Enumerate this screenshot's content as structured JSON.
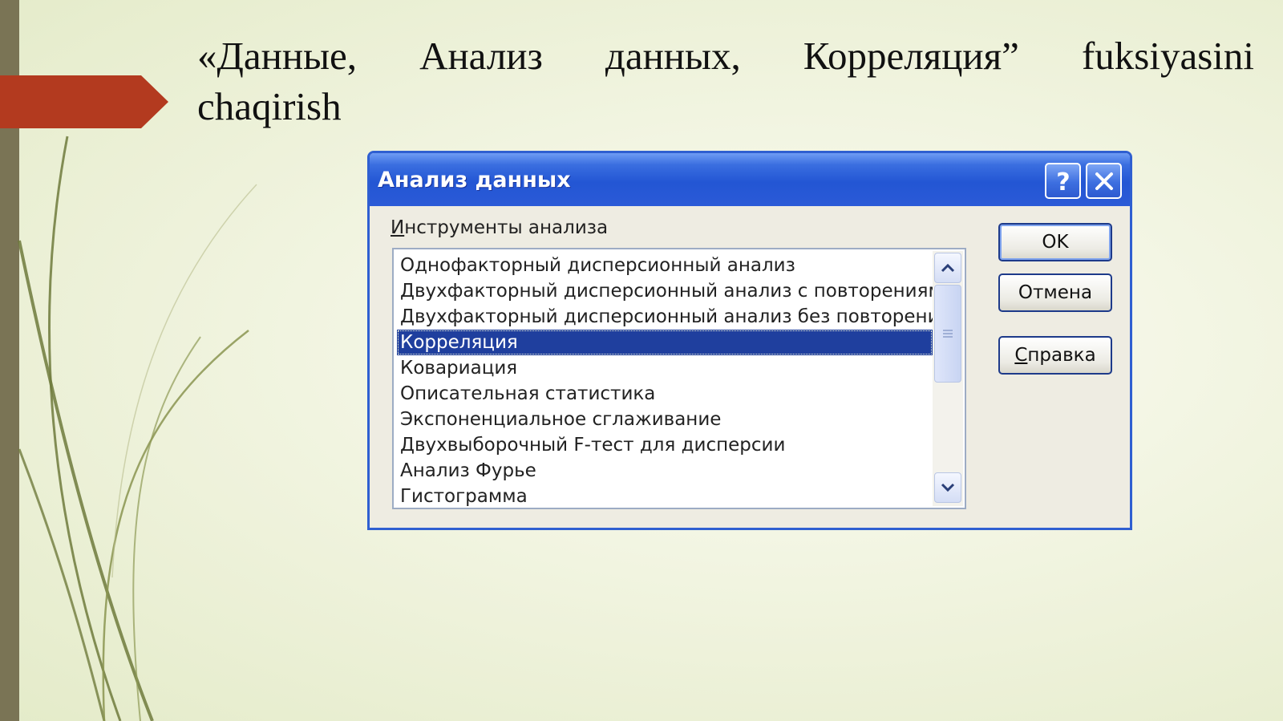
{
  "slide": {
    "title_words": [
      "«Данные,",
      "Анализ",
      "данных,",
      "Корреляция”",
      "fuksiyasini"
    ],
    "title_line2": "chaqirish"
  },
  "dialog": {
    "title": "Анализ данных",
    "help_icon": "question-mark-icon",
    "close_icon": "close-icon",
    "tools_label_first": "И",
    "tools_label_rest": "нструменты анализа",
    "list_items": [
      "Однофакторный дисперсионный анализ",
      "Двухфакторный дисперсионный анализ с повторениями",
      "Двухфакторный дисперсионный анализ без повторений",
      "Корреляция",
      "Ковариация",
      "Описательная статистика",
      "Экспоненциальное сглаживание",
      "Двухвыборочный F-тест для дисперсии",
      "Анализ Фурье",
      "Гистограмма"
    ],
    "selected_item": "Корреляция",
    "ok_label": "OK",
    "cancel_label": "Отмена",
    "help_label_first": "С",
    "help_label_rest": "правка"
  },
  "colors": {
    "titlebar": "#2356d4",
    "selection": "#1f3f9e",
    "accent_arrow": "#b33a1f",
    "left_strip": "#7a7455"
  }
}
